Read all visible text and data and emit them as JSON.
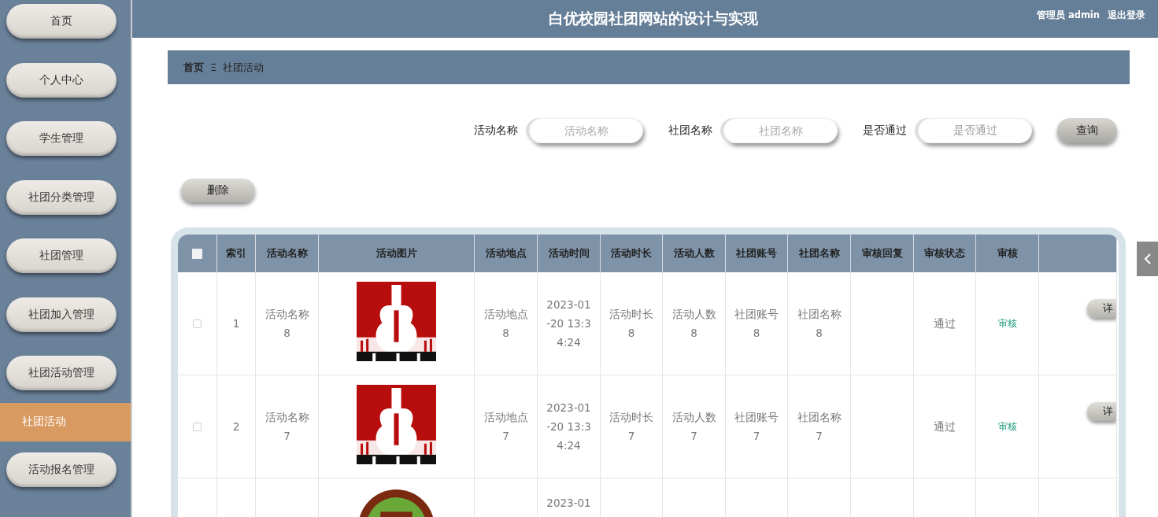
{
  "header": {
    "title": "白优校园社团网站的设计与实现",
    "user": "管理员 admin",
    "logout": "退出登录"
  },
  "sidebar": {
    "items": [
      {
        "label": "首页",
        "selected": false
      },
      {
        "label": "个人中心",
        "selected": false
      },
      {
        "label": "学生管理",
        "selected": false
      },
      {
        "label": "社团分类管理",
        "selected": false
      },
      {
        "label": "社团管理",
        "selected": false
      },
      {
        "label": "社团加入管理",
        "selected": false
      },
      {
        "label": "社团活动管理",
        "selected": false
      },
      {
        "label": "社团活动",
        "selected": true
      },
      {
        "label": "活动报名管理",
        "selected": false
      }
    ]
  },
  "breadcrumb": {
    "home": "首页",
    "separator": "Ξ",
    "current": "社团活动"
  },
  "search": {
    "fields": [
      {
        "label": "活动名称",
        "placeholder": "活动名称",
        "kind": "input"
      },
      {
        "label": "社团名称",
        "placeholder": "社团名称",
        "kind": "input"
      },
      {
        "label": "是否通过",
        "placeholder": "是否通过",
        "kind": "select"
      }
    ],
    "button": "查询"
  },
  "delete_button": "删除",
  "table": {
    "header_checked": false,
    "columns": [
      "索引",
      "活动名称",
      "活动图片",
      "活动地点",
      "活动时间",
      "活动时长",
      "活动人数",
      "社团账号",
      "社团名称",
      "审核回复",
      "审核状态",
      "审核"
    ],
    "rows": [
      {
        "checked": false,
        "index": "1",
        "name": "活动名称8",
        "place": "活动地点8",
        "time": "2023-01-20 13:34:24",
        "duration": "活动时长8",
        "people": "活动人数8",
        "account": "社团账号8",
        "club": "社团名称8",
        "reply": "",
        "status": "通过",
        "review": "审核",
        "detail": "详"
      },
      {
        "checked": false,
        "index": "2",
        "name": "活动名称7",
        "place": "活动地点7",
        "time": "2023-01-20 13:34:24",
        "duration": "活动时长7",
        "people": "活动人数7",
        "account": "社团账号7",
        "club": "社团名称7",
        "reply": "",
        "status": "通过",
        "review": "审核",
        "detail": "详"
      },
      {
        "time": "2023-01"
      }
    ]
  }
}
